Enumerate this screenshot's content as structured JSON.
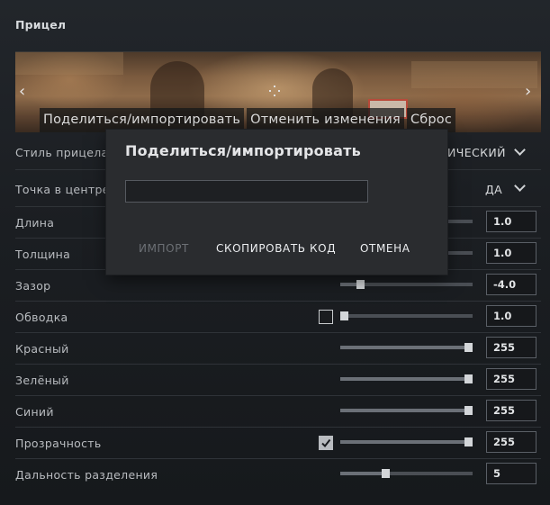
{
  "panel": {
    "title": "Прицел"
  },
  "preview": {
    "toolbar": [
      "Поделиться/импортировать",
      "Отменить изменения",
      "Сброс"
    ],
    "prev_icon": "chevron-left-icon",
    "next_icon": "chevron-right-icon"
  },
  "rows": {
    "style": {
      "label": "Стиль прицела",
      "value": "ИЧЕСКИЙ"
    },
    "center_dot": {
      "label": "Точка в центре",
      "value": "ДА"
    },
    "length": {
      "label": "Длина",
      "value": "1.0",
      "level": 0.2
    },
    "thickness": {
      "label": "Толщина",
      "value": "1.0",
      "level": 0.2
    },
    "gap": {
      "label": "Зазор",
      "value": "-4.0",
      "level": 0.13
    },
    "outline": {
      "label": "Обводка",
      "value": "1.0",
      "checked": false,
      "level": 0.0
    },
    "red": {
      "label": "Красный",
      "value": "255",
      "level": 1.0
    },
    "green": {
      "label": "Зелёный",
      "value": "255",
      "level": 1.0
    },
    "blue": {
      "label": "Синий",
      "value": "255",
      "level": 1.0
    },
    "alpha": {
      "label": "Прозрачность",
      "value": "255",
      "checked": true,
      "level": 1.0
    },
    "split_distance": {
      "label": "Дальность разделения",
      "value": "5",
      "level": 0.33
    }
  },
  "dialog": {
    "title": "Поделиться/импортировать",
    "input_value": "",
    "import_label": "ИМПОРТ",
    "copy_label": "СКОПИРОВАТЬ КОД",
    "cancel_label": "ОТМЕНА"
  },
  "colors": {
    "background": "#1a1d22",
    "dialog": "#2a2c2f",
    "text": "#c6c9cd",
    "slider_track": "#4a4e54",
    "slider_thumb": "#d3d6d9"
  }
}
